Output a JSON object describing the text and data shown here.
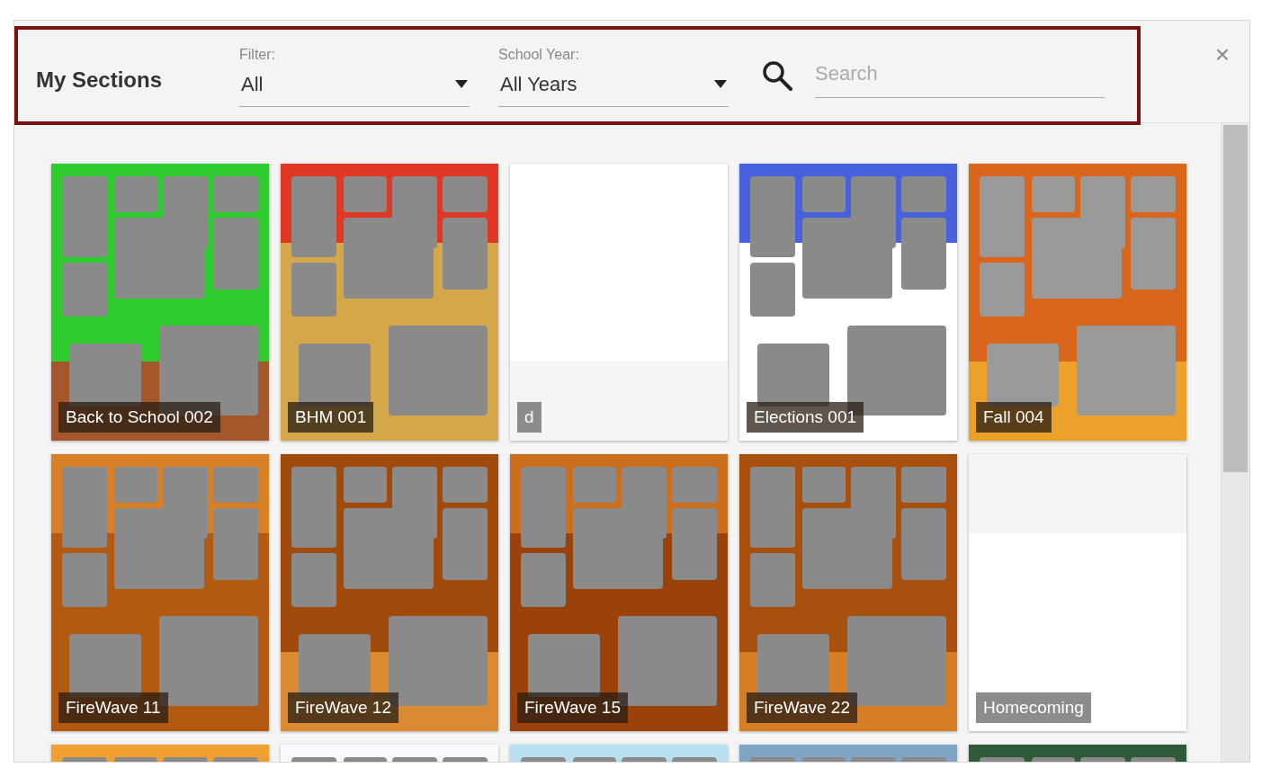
{
  "header": {
    "title": "My Sections",
    "filter": {
      "label": "Filter:",
      "value": "All"
    },
    "school_year": {
      "label": "School Year:",
      "value": "All Years"
    },
    "search": {
      "placeholder": "Search"
    },
    "close": "×"
  },
  "sections": [
    {
      "kind": "picture",
      "caption": "Back to School 002"
    },
    {
      "kind": "picture",
      "caption": "BHM 001"
    },
    {
      "kind": "picture",
      "caption": "d"
    },
    {
      "kind": "picture",
      "caption": "Elections 001"
    },
    {
      "kind": "picture",
      "caption": "Fall 004"
    },
    {
      "kind": "picture",
      "caption": "FireWave 11"
    },
    {
      "kind": "picture",
      "caption": "FireWave 12"
    },
    {
      "kind": "picture",
      "caption": "FireWave 15"
    },
    {
      "kind": "picture",
      "caption": "FireWave 22"
    },
    {
      "kind": "picture",
      "caption": "Homecoming"
    },
    {
      "kind": "picture"
    },
    {
      "kind": "picture"
    },
    {
      "kind": "picture"
    },
    {
      "kind": "picture"
    },
    {
      "kind": "picture"
    }
  ]
}
